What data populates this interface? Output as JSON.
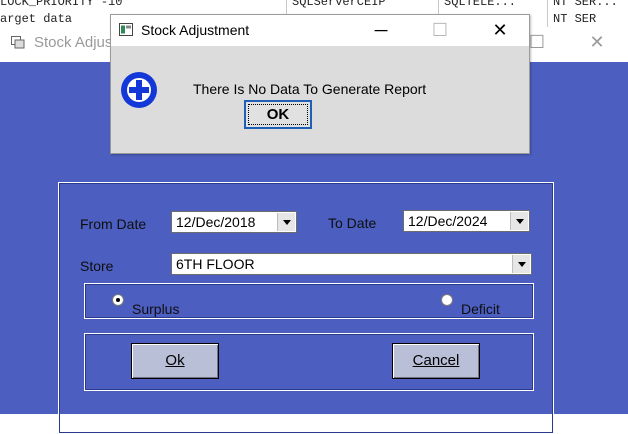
{
  "background_table": {
    "row1": {
      "col1": "LOCK_PRIORITY -10",
      "col2": "SQLServerCEIP",
      "col3": "SQLTELE...",
      "col4": "NT SER..."
    },
    "row2": {
      "col1": "arget data",
      "col4": "NT SER"
    }
  },
  "main_window": {
    "title": "Stock Adjus",
    "minimize_glyph": "─",
    "maximize_glyph": "☐",
    "close_glyph": "✕",
    "from_date_label": "From Date",
    "from_date_value": "12/Dec/2018",
    "to_date_label": "To Date",
    "to_date_value": "12/Dec/2024",
    "store_label": "Store",
    "store_value": "6TH FLOOR",
    "surplus_label": "Surplus",
    "surplus_selected": true,
    "deficit_label": "Deficit",
    "deficit_selected": false,
    "ok_label": "Ok",
    "cancel_label": "Cancel"
  },
  "dialog": {
    "title": "Stock Adjustment",
    "minimize_glyph": "─",
    "maximize_glyph": "☐",
    "close_glyph": "✕",
    "message": "There Is No Data To Generate Report",
    "icon": "info-plus-icon",
    "ok_label": "OK"
  },
  "colors": {
    "window_body": "#4c5fc0",
    "button_face": "#b9bfd6",
    "dialog_body": "#dcdcdc",
    "info_icon": "#1438d8",
    "focus_border": "#1f5fb5"
  }
}
